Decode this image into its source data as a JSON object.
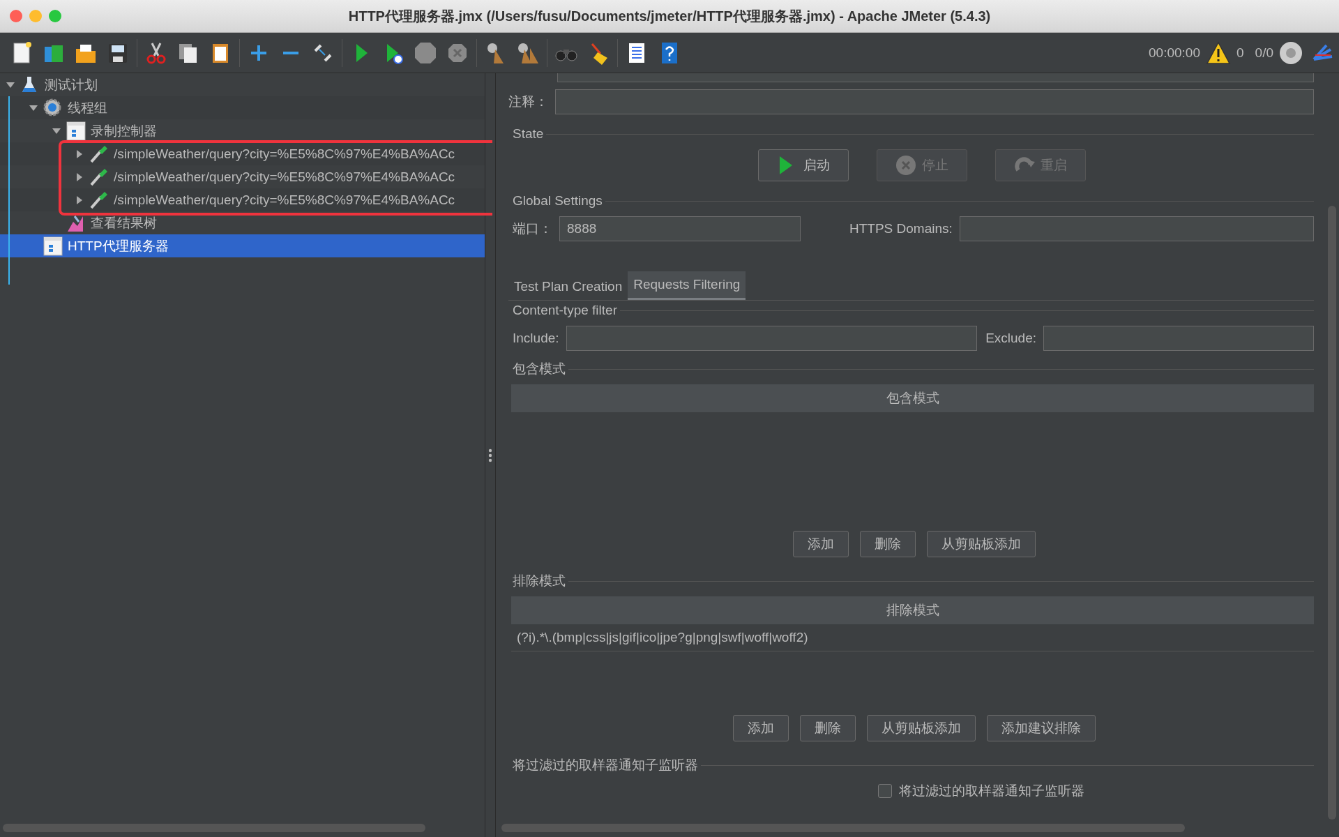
{
  "window": {
    "title": "HTTP代理服务器.jmx (/Users/fusu/Documents/jmeter/HTTP代理服务器.jmx) - Apache JMeter (5.4.3)"
  },
  "status": {
    "timer": "00:00:00",
    "warnings": "0",
    "threads": "0/0"
  },
  "tree": [
    {
      "label": "测试计划",
      "kind": "plan",
      "expanded": true,
      "selected": false,
      "children": [
        {
          "label": "线程组",
          "kind": "threads",
          "expanded": true,
          "selected": false,
          "children": [
            {
              "label": "录制控制器",
              "kind": "controller",
              "expanded": true,
              "selected": false,
              "children": [
                {
                  "label": "/simpleWeather/query?city=%E5%8C%97%E4%BA%ACc",
                  "kind": "sampler",
                  "expanded": false,
                  "selected": false
                },
                {
                  "label": "/simpleWeather/query?city=%E5%8C%97%E4%BA%ACc",
                  "kind": "sampler",
                  "expanded": false,
                  "selected": false
                },
                {
                  "label": "/simpleWeather/query?city=%E5%8C%97%E4%BA%ACc",
                  "kind": "sampler",
                  "expanded": false,
                  "selected": false
                }
              ]
            },
            {
              "label": "查看结果树",
              "kind": "listener",
              "selected": false
            }
          ]
        },
        {
          "label": "HTTP代理服务器",
          "kind": "proxy",
          "selected": true
        }
      ]
    }
  ],
  "panel": {
    "comment_label": "注释：",
    "state": {
      "legend": "State",
      "buttons": [
        {
          "label": "启动",
          "kind": "start",
          "disabled": false
        },
        {
          "label": "停止",
          "kind": "stop",
          "disabled": true
        },
        {
          "label": "重启",
          "kind": "restart",
          "disabled": true
        }
      ]
    },
    "global": {
      "legend": "Global Settings",
      "port_label": "端口：",
      "port": "8888",
      "https_label": "HTTPS Domains:"
    },
    "tabs": [
      {
        "label": "Test Plan Creation",
        "selected": false
      },
      {
        "label": "Requests Filtering",
        "selected": true
      }
    ],
    "content_type": {
      "legend": "Content-type filter",
      "include_label": "Include:",
      "exclude_label": "Exclude:"
    },
    "include_patterns": {
      "legend": "包含模式",
      "header": "包含模式",
      "buttons": [
        "添加",
        "删除",
        "从剪贴板添加"
      ]
    },
    "exclude_patterns": {
      "legend": "排除模式",
      "header": "排除模式",
      "rows": [
        "(?i).*\\.(bmp|css|js|gif|ico|jpe?g|png|swf|woff|woff2)"
      ],
      "buttons": [
        "添加",
        "删除",
        "从剪贴板添加",
        "添加建议排除"
      ]
    },
    "notify": {
      "legend": "将过滤过的取样器通知子监听器",
      "label": "将过滤过的取样器通知子监听器",
      "checked": false
    }
  }
}
